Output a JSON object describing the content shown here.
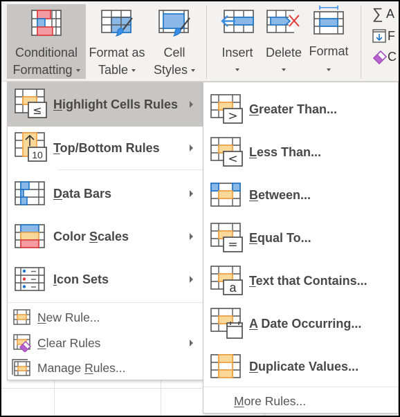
{
  "ribbon": {
    "buttons": [
      {
        "id": "conditional-formatting",
        "line1": "Conditional",
        "line2": "Formatting",
        "has_dropdown": true,
        "active": true
      },
      {
        "id": "format-as-table",
        "line1": "Format as",
        "line2": "Table",
        "has_dropdown": true
      },
      {
        "id": "cell-styles",
        "line1": "Cell",
        "line2": "Styles",
        "has_dropdown": true
      },
      {
        "id": "insert",
        "line1": "Insert",
        "has_dropdown": true
      },
      {
        "id": "delete",
        "line1": "Delete",
        "has_dropdown": true
      },
      {
        "id": "format",
        "line1": "Format",
        "has_dropdown": true
      }
    ],
    "editing": [
      {
        "icon": "autosum-icon",
        "label": "A"
      },
      {
        "icon": "fill-icon",
        "label": "F"
      },
      {
        "icon": "clear-eraser-icon",
        "label": "C"
      }
    ]
  },
  "main_menu": {
    "items": [
      {
        "label": "Highlight Cells Rules",
        "accel": "H",
        "rest": "ighlight Cells Rules",
        "icon": "highlight-cells-rules-icon",
        "submenu": true,
        "selected": true
      },
      {
        "label": "Top/Bottom Rules",
        "accel": "T",
        "rest": "op/Bottom Rules",
        "icon": "top-bottom-rules-icon",
        "submenu": true
      },
      {
        "label": "Data Bars",
        "accel": "D",
        "rest": "ata Bars",
        "icon": "data-bars-icon",
        "submenu": true
      },
      {
        "label": "Color Scales",
        "pre": "Color ",
        "accel": "S",
        "rest": "cales",
        "icon": "color-scales-icon",
        "submenu": true
      },
      {
        "label": "Icon Sets",
        "accel": "I",
        "rest": "con Sets",
        "icon": "icon-sets-icon",
        "submenu": true
      },
      {
        "label": "New Rule...",
        "accel": "N",
        "rest": "ew Rule...",
        "icon": "new-rule-icon",
        "submenu": false
      },
      {
        "label": "Clear Rules",
        "accel": "C",
        "rest": "lear Rules",
        "icon": "clear-rules-icon",
        "submenu": true
      },
      {
        "label": "Manage Rules...",
        "pre": "Manage ",
        "accel": "R",
        "rest": "ules...",
        "icon": "manage-rules-icon",
        "submenu": false
      }
    ]
  },
  "sub_menu": {
    "items": [
      {
        "label": "Greater Than...",
        "accel": "G",
        "rest": "reater Than...",
        "icon": "greater-than-icon",
        "symbol": ">"
      },
      {
        "label": "Less Than...",
        "accel": "L",
        "rest": "ess Than...",
        "icon": "less-than-icon",
        "symbol": "<"
      },
      {
        "label": "Between...",
        "accel": "B",
        "rest": "etween...",
        "icon": "between-icon"
      },
      {
        "label": "Equal To...",
        "accel": "E",
        "rest": "qual To...",
        "icon": "equal-to-icon",
        "symbol": "="
      },
      {
        "label": "Text that Contains...",
        "accel": "T",
        "rest": "ext that Contains...",
        "icon": "text-contains-icon",
        "symbol": "a"
      },
      {
        "label": "A Date Occurring...",
        "accel": "A",
        "rest": " Date Occurring...",
        "icon": "date-occurring-icon"
      },
      {
        "label": "Duplicate Values...",
        "accel": "D",
        "rest": "uplicate Values...",
        "icon": "duplicate-values-icon"
      },
      {
        "label": "More Rules...",
        "accel": "M",
        "rest": "ore Rules...",
        "icon": null
      }
    ]
  },
  "symbols": {
    "lte": "≤",
    "top10": "10",
    "arrow_up": "↑"
  },
  "colors": {
    "highlight_orange": "#f4a13c",
    "highlight_fill": "#fad89a",
    "blue": "#1a73c8",
    "blue_fill": "#8ab9e8",
    "red": "#e03a3a",
    "red_fill": "#f59ba3",
    "purple": "#a54fbd",
    "selected_bg": "#c8c6c4"
  }
}
